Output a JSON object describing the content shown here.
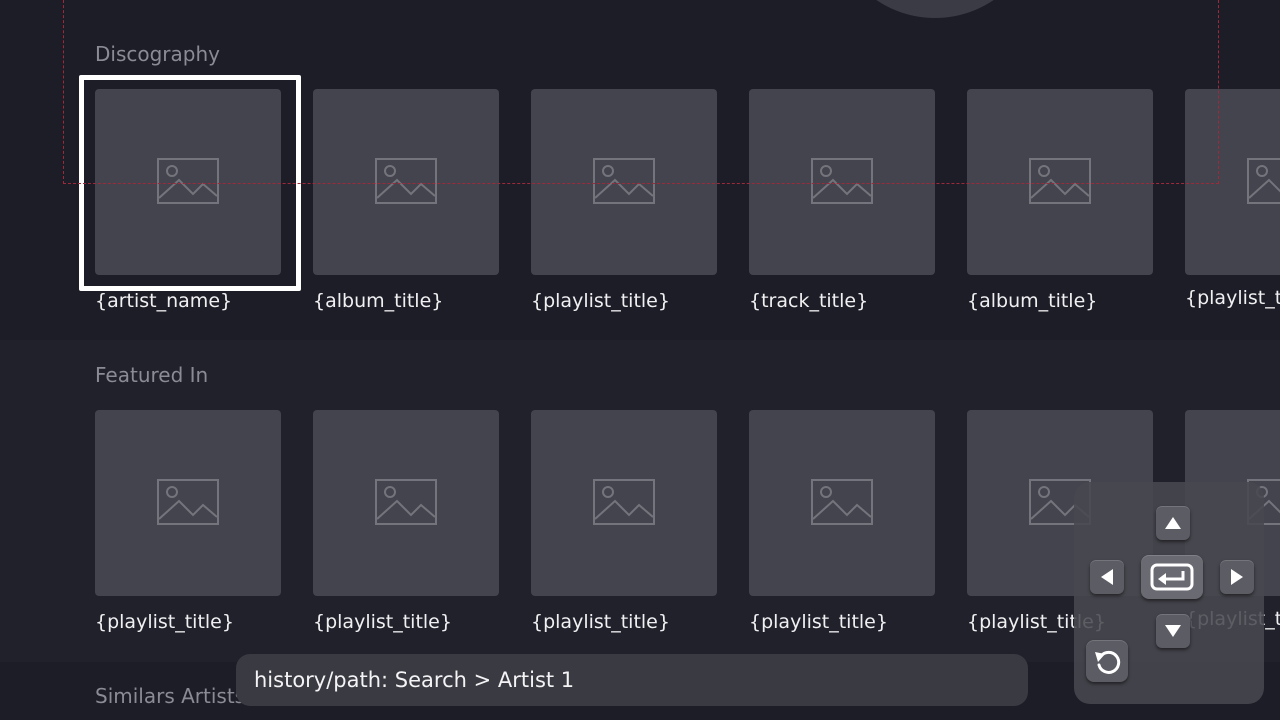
{
  "sections": {
    "discography": {
      "title": "Discography",
      "items": [
        {
          "label": "{artist_name}"
        },
        {
          "label": "{album_title}"
        },
        {
          "label": "{playlist_title}"
        },
        {
          "label": "{track_title}"
        },
        {
          "label": "{album_title}"
        },
        {
          "label": "{playlist_t"
        }
      ]
    },
    "featured_in": {
      "title": "Featured In",
      "items": [
        {
          "label": "{playlist_title}"
        },
        {
          "label": "{playlist_title}"
        },
        {
          "label": "{playlist_title}"
        },
        {
          "label": "{playlist_title}"
        },
        {
          "label": "{playlist_title}"
        },
        {
          "label": "{playlist_t"
        }
      ]
    },
    "similars": {
      "title": "Similars Artists"
    }
  },
  "history": {
    "text": "history/path: Search > Artist 1"
  },
  "remote": {
    "buttons": [
      "up-arrow-icon",
      "left-arrow-icon",
      "enter-icon",
      "right-arrow-icon",
      "down-arrow-icon",
      "back-icon"
    ]
  },
  "colors": {
    "background": "#1d1d27",
    "tile": "#44444e",
    "focus": "#ffffff",
    "guide_line": "#9c2a3a"
  }
}
